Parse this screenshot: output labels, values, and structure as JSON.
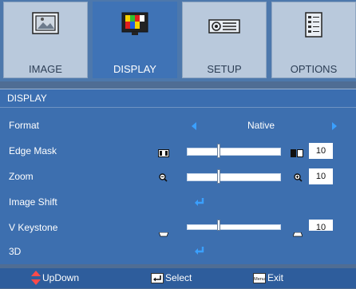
{
  "tabs": [
    {
      "label": "IMAGE",
      "icon": "image-icon"
    },
    {
      "label": "DISPLAY",
      "icon": "display-icon"
    },
    {
      "label": "SETUP",
      "icon": "projector-icon"
    },
    {
      "label": "OPTIONS",
      "icon": "options-icon"
    }
  ],
  "active_tab": "DISPLAY",
  "section_title": "DISPLAY",
  "menu": {
    "format": {
      "label": "Format",
      "value": "Native"
    },
    "edge_mask": {
      "label": "Edge Mask",
      "value": "10"
    },
    "zoom": {
      "label": "Zoom",
      "value": "10"
    },
    "image_shift": {
      "label": "Image Shift"
    },
    "v_keystone": {
      "label": "V Keystone",
      "value": "10"
    },
    "three_d": {
      "label": "3D"
    }
  },
  "footer": {
    "updown": "UpDown",
    "select": "Select",
    "exit": "Exit",
    "menu_key": "Menu"
  },
  "colors": {
    "accent": "#3aa0ff",
    "panel": "#3d6faf",
    "tab_active": "#3f73b6",
    "tab_inactive": "#b9c9dc",
    "updown_arrow": "#ff4a4a"
  }
}
